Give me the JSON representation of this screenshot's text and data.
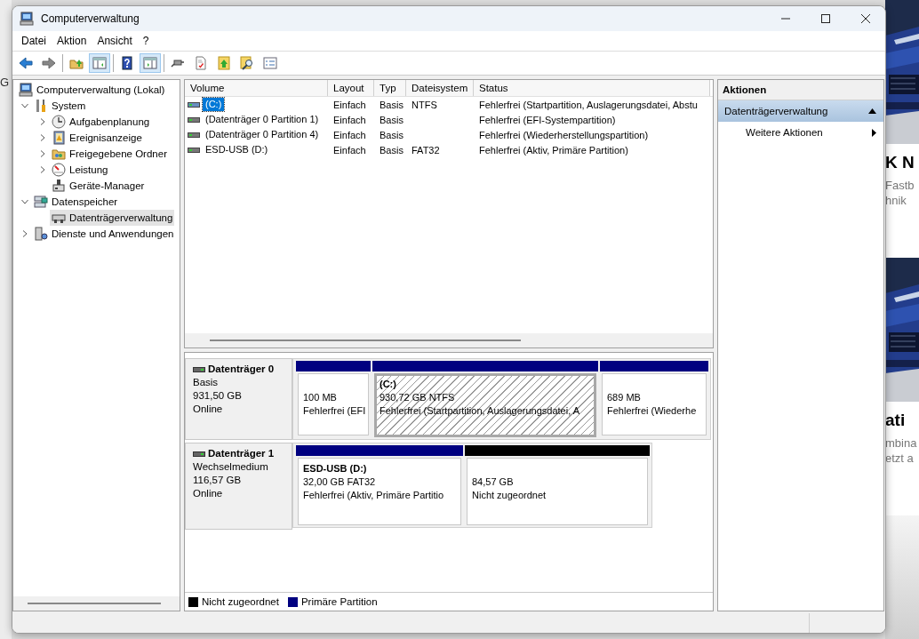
{
  "window": {
    "title": "Computerverwaltung"
  },
  "menu": [
    "Datei",
    "Aktion",
    "Ansicht",
    "?"
  ],
  "toolbar": [
    {
      "pressed": false
    },
    {
      "pressed": false
    },
    {
      "pressed": false
    },
    {
      "pressed": true
    },
    {
      "pressed": false
    },
    {
      "pressed": true
    },
    {
      "pressed": false
    },
    {
      "pressed": false
    },
    {
      "pressed": false
    },
    {
      "pressed": false
    },
    {
      "pressed": false
    }
  ],
  "tree": [
    {
      "label": "Computerverwaltung (Lokal)",
      "selected": false,
      "children": [
        {
          "label": "System",
          "expanded": true,
          "selected": false,
          "children": [
            {
              "label": "Aufgabenplanung",
              "expanded": false,
              "selected": false
            },
            {
              "label": "Ereignisanzeige",
              "expanded": false,
              "selected": false
            },
            {
              "label": "Freigegebene Ordner",
              "expanded": false,
              "selected": false
            },
            {
              "label": "Leistung",
              "expanded": false,
              "selected": false
            },
            {
              "label": "Geräte-Manager",
              "selected": false
            }
          ]
        },
        {
          "label": "Datenspeicher",
          "expanded": true,
          "selected": false,
          "children": [
            {
              "label": "Datenträgerverwaltung",
              "selected": true
            }
          ]
        },
        {
          "label": "Dienste und Anwendungen",
          "expanded": false,
          "selected": false
        }
      ]
    }
  ],
  "volumes": {
    "columns": [
      "Volume",
      "Layout",
      "Typ",
      "Dateisystem",
      "Status"
    ],
    "rows": [
      {
        "cells": [
          "(C:)",
          "Einfach",
          "Basis",
          "NTFS",
          "Fehlerfrei (Startpartition, Auslagerungsdatei, Abstu"
        ],
        "selected": true
      },
      {
        "cells": [
          "(Datenträger 0 Partition 1)",
          "Einfach",
          "Basis",
          "",
          "Fehlerfrei (EFI-Systempartition)"
        ],
        "selected": false
      },
      {
        "cells": [
          "(Datenträger 0 Partition 4)",
          "Einfach",
          "Basis",
          "",
          "Fehlerfrei (Wiederherstellungspartition)"
        ],
        "selected": false
      },
      {
        "cells": [
          "ESD-USB (D:)",
          "Einfach",
          "Basis",
          "FAT32",
          "Fehlerfrei (Aktiv, Primäre Partition)"
        ],
        "selected": false
      }
    ]
  },
  "disks": [
    {
      "name": "Datenträger 0",
      "type": "Basis",
      "size": "931,50 GB",
      "state": "Online",
      "partitions": [
        {
          "lines": [
            "100 MB",
            "Fehlerfrei (EFI"
          ],
          "color": "#000080",
          "selected": false
        },
        {
          "name": "(C:)",
          "lines": [
            "930,72 GB NTFS",
            "Fehlerfrei (Startpartition, Auslagerungsdatei, A"
          ],
          "color": "#000080",
          "selected": true
        },
        {
          "lines": [
            "689 MB",
            "Fehlerfrei (Wiederhe"
          ],
          "color": "#000080",
          "selected": false
        }
      ]
    },
    {
      "name": "Datenträger 1",
      "type": "Wechselmedium",
      "size": "116,57 GB",
      "state": "Online",
      "partitions": [
        {
          "name": "ESD-USB  (D:)",
          "lines": [
            "32,00 GB FAT32",
            "Fehlerfrei (Aktiv, Primäre Partitio"
          ],
          "color": "#000080",
          "selected": false
        },
        {
          "lines": [
            "84,57 GB",
            "Nicht zugeordnet"
          ],
          "color": "#000000",
          "selected": false
        }
      ]
    }
  ],
  "legend": [
    {
      "label": "Nicht zugeordnet",
      "color": "#000000"
    },
    {
      "label": "Primäre Partition",
      "color": "#000080"
    }
  ],
  "actions": {
    "title": "Aktionen",
    "sections": [
      {
        "label": "Datenträgerverwaltung",
        "expanded": true,
        "items": [
          "Weitere Aktionen"
        ]
      }
    ]
  },
  "background": {
    "left_text": "G",
    "blocks": [
      {
        "headline": "K N",
        "lines": [
          "Fastb",
          "hnik"
        ]
      },
      {
        "headline": "ati",
        "lines": [
          "mbina",
          "etzt a"
        ]
      }
    ]
  }
}
